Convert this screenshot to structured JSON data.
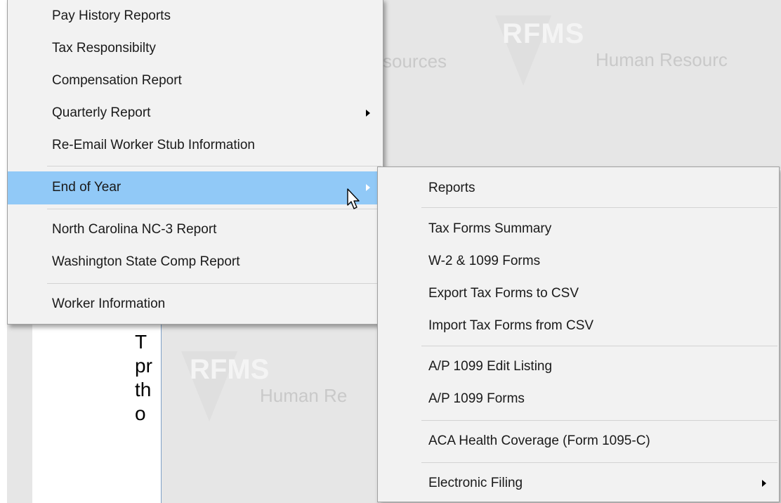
{
  "background": {
    "watermark_logo": "RFMS",
    "watermark_subtitle": "Human Resources",
    "watermark_partial_left": "sources",
    "watermark_partial_right": "Human Resourc",
    "watermark_partial_center": "Human Re",
    "body_text_lines": [
      "T",
      "pr",
      "th",
      "o"
    ]
  },
  "main_menu": {
    "items": [
      {
        "label": "Pay History Reports"
      },
      {
        "label": "Tax Responsibilty"
      },
      {
        "label": "Compensation Report"
      },
      {
        "label": "Quarterly Report",
        "has_submenu": true
      },
      {
        "label": "Re-Email Worker Stub Information"
      },
      {
        "label": "End of Year",
        "has_submenu": true,
        "highlighted": true
      },
      {
        "label": "North Carolina NC-3 Report"
      },
      {
        "label": "Washington State Comp Report"
      },
      {
        "label": "Worker Information"
      }
    ]
  },
  "submenu": {
    "items": [
      {
        "label": "Reports"
      },
      {
        "label": "Tax Forms Summary"
      },
      {
        "label": "W-2 & 1099 Forms"
      },
      {
        "label": "Export Tax Forms to CSV"
      },
      {
        "label": "Import Tax Forms from CSV"
      },
      {
        "label": "A/P 1099 Edit Listing"
      },
      {
        "label": "A/P 1099 Forms"
      },
      {
        "label": "ACA Health Coverage (Form 1095-C)"
      },
      {
        "label": "Electronic Filing",
        "has_submenu": true
      }
    ]
  },
  "colors": {
    "highlight": "#91c9f7",
    "menu_bg": "#f2f2f2",
    "app_gray": "#e6e6e6"
  }
}
